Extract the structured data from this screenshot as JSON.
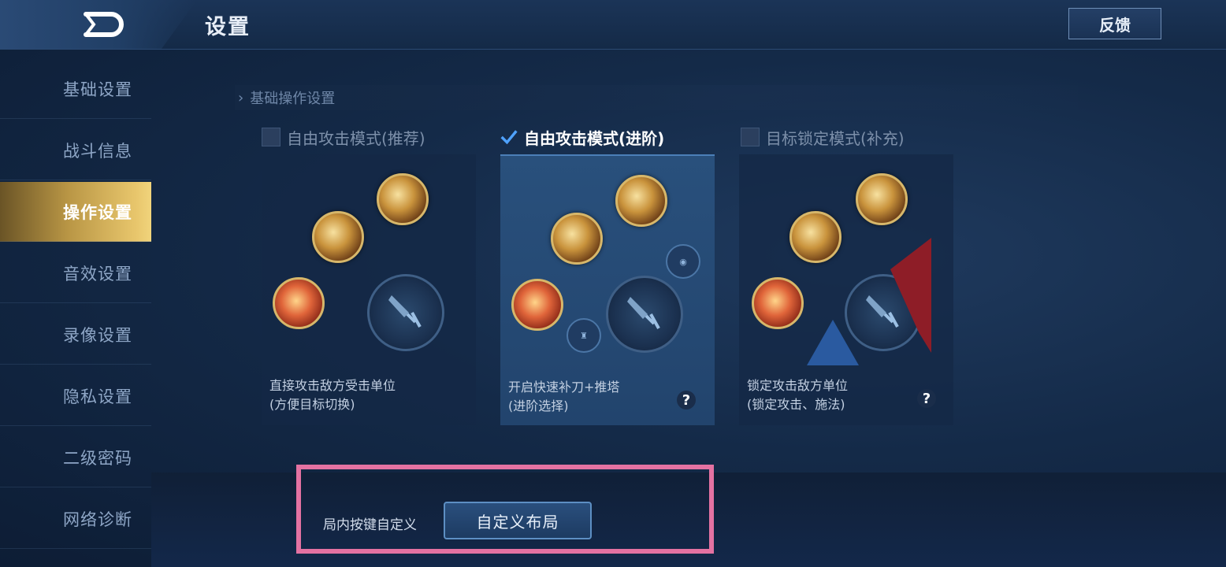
{
  "header": {
    "title": "设置",
    "feedback_label": "反馈"
  },
  "sidebar": {
    "items": [
      {
        "label": "基础设置",
        "active": false
      },
      {
        "label": "战斗信息",
        "active": false
      },
      {
        "label": "操作设置",
        "active": true
      },
      {
        "label": "音效设置",
        "active": false
      },
      {
        "label": "录像设置",
        "active": false
      },
      {
        "label": "隐私设置",
        "active": false
      },
      {
        "label": "二级密码",
        "active": false
      },
      {
        "label": "网络诊断",
        "active": false
      }
    ]
  },
  "section": {
    "title": "基础操作设置"
  },
  "modes": [
    {
      "label": "自由攻击模式(推荐)",
      "checked": false,
      "desc_line1": "直接攻击敌方受击单位",
      "desc_line2": "(方便目标切换)"
    },
    {
      "label": "自由攻击模式(进阶)",
      "checked": true,
      "desc_line1": "开启快速补刀+推塔",
      "desc_line2": "(进阶选择)",
      "help": "?"
    },
    {
      "label": "目标锁定模式(补充)",
      "checked": false,
      "desc_line1": "锁定攻击敌方单位",
      "desc_line2": "(锁定攻击、施法)",
      "help": "?"
    }
  ],
  "bottom": {
    "custom_key_label": "局内按键自定义",
    "custom_layout_button": "自定义布局"
  },
  "colors": {
    "active_tab_gold": "#e8c66c",
    "highlight_pink": "#e472a2",
    "selected_card": "#29507c"
  },
  "icons": [
    "back-icon",
    "checkmark-icon",
    "help-icon",
    "skill-icon",
    "attack-sword-icon"
  ]
}
